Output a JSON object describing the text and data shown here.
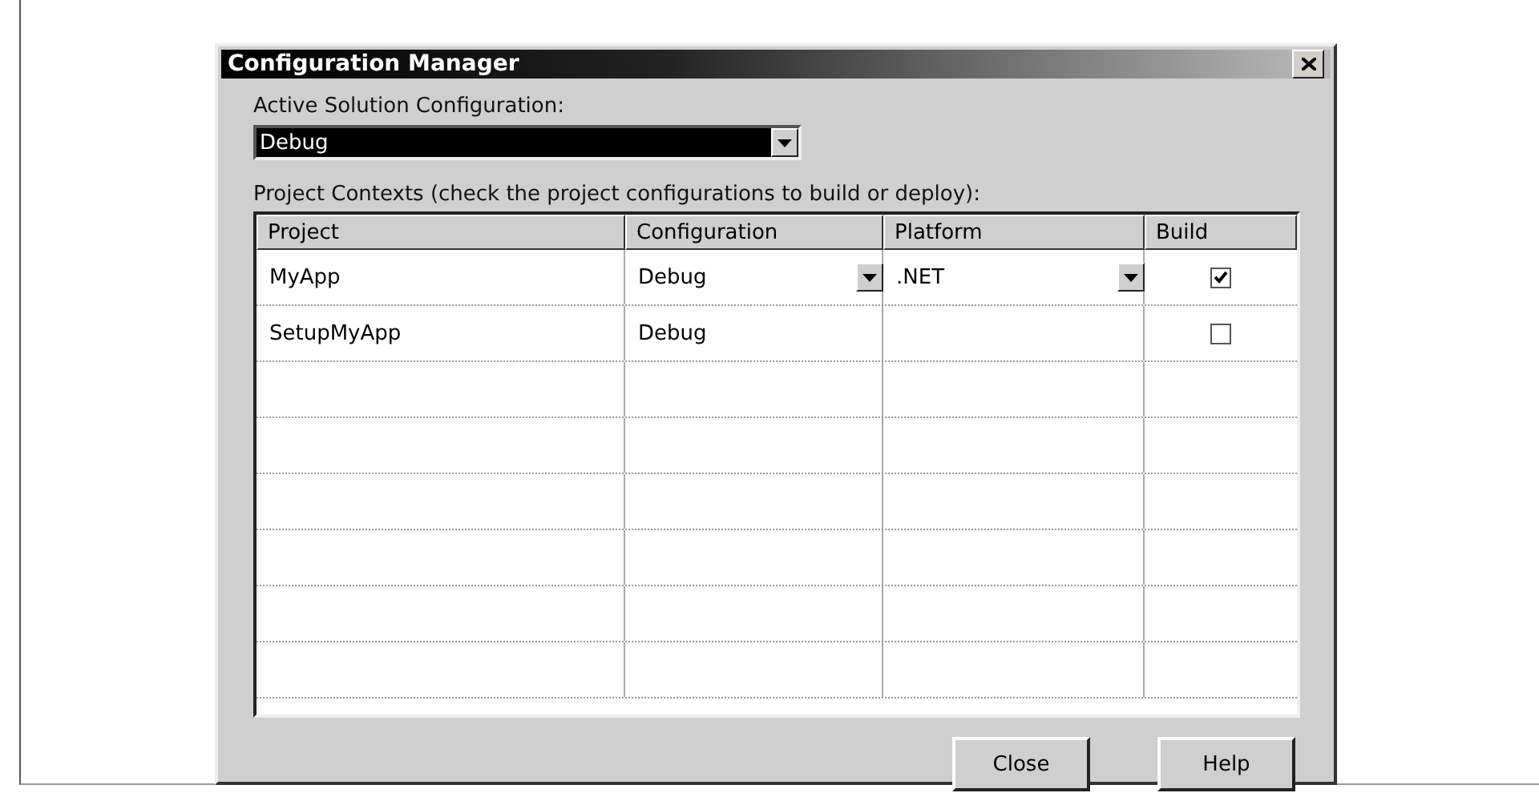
{
  "window": {
    "title": "Configuration Manager"
  },
  "active_solution_configuration": {
    "label": "Active Solution Configuration:",
    "value": "Debug"
  },
  "project_contexts": {
    "label": "Project Contexts (check the project configurations to build or deploy):",
    "columns": [
      "Project",
      "Configuration",
      "Platform",
      "Build"
    ],
    "rows": [
      {
        "project": "MyApp",
        "configuration": "Debug",
        "configuration_dropdown": true,
        "platform": ".NET",
        "platform_dropdown": true,
        "build": true
      },
      {
        "project": "SetupMyApp",
        "configuration": "Debug",
        "configuration_dropdown": false,
        "build": false
      }
    ]
  },
  "buttons": [
    "Close",
    "Help"
  ]
}
